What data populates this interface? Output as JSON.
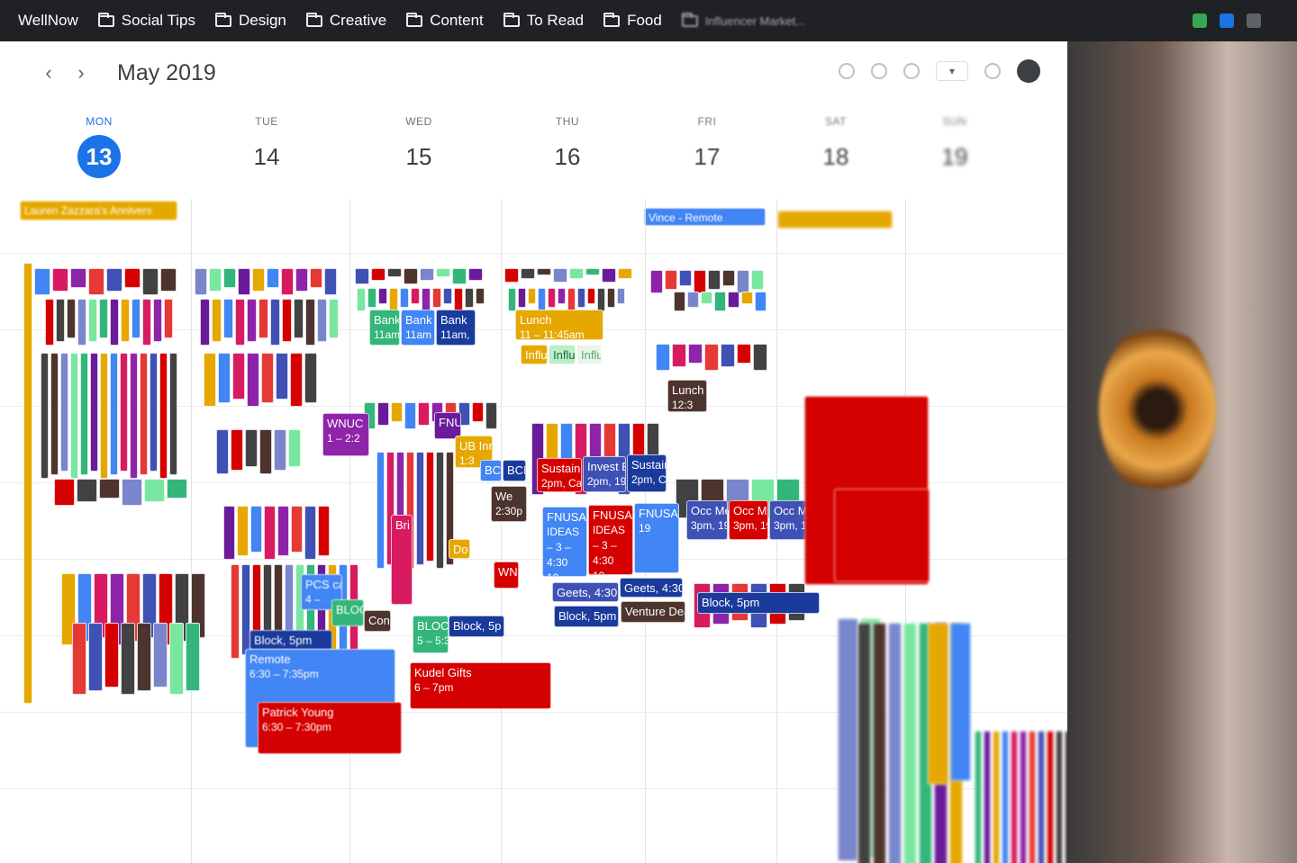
{
  "bookmarks": [
    {
      "label": "WellNow"
    },
    {
      "label": "Social Tips"
    },
    {
      "label": "Design"
    },
    {
      "label": "Creative"
    },
    {
      "label": "Content"
    },
    {
      "label": "To Read"
    },
    {
      "label": "Food"
    },
    {
      "label": "Influencer Market..."
    }
  ],
  "header": {
    "prev": "‹",
    "next": "›",
    "month_title": "May 2019"
  },
  "days": [
    {
      "dow": "MON",
      "num": "13"
    },
    {
      "dow": "TUE",
      "num": "14"
    },
    {
      "dow": "WED",
      "num": "15"
    },
    {
      "dow": "THU",
      "num": "16"
    },
    {
      "dow": "FRI",
      "num": "17"
    },
    {
      "dow": "SAT",
      "num": "18"
    },
    {
      "dow": "SUN",
      "num": "19"
    }
  ],
  "allday": [
    {
      "label": "Lauren Zazzara's Annivers"
    },
    {
      "label": "Vince - Remote"
    }
  ],
  "events": [
    {
      "title": "Bank",
      "time": "11am"
    },
    {
      "title": "Bank",
      "time": "11am"
    },
    {
      "title": "Bank",
      "time": "11am,"
    },
    {
      "title": "Lunch",
      "time": "11 – 11:45am"
    },
    {
      "title": "Influ",
      "time": ""
    },
    {
      "title": "Influ",
      "time": ""
    },
    {
      "title": "Influ",
      "time": ""
    },
    {
      "title": "Lunch",
      "time": "12:3"
    },
    {
      "title": "WNUC",
      "time": "1 – 2:2"
    },
    {
      "title": "FNU",
      "time": ""
    },
    {
      "title": "UB Inn",
      "time": "1:3"
    },
    {
      "title": "BC",
      "time": ""
    },
    {
      "title": "BCI",
      "time": ""
    },
    {
      "title": "Sustain",
      "time": "2pm, Ca"
    },
    {
      "title": "Invest B",
      "time": "2pm, 19"
    },
    {
      "title": "Sustain",
      "time": "2pm, Ca"
    },
    {
      "title": "We",
      "time": "2:30p"
    },
    {
      "title": "FNUSA",
      "time": "IDEAS – 3 – 4:30 19 IDEA"
    },
    {
      "title": "FNUSA",
      "time": "IDEAS – 3 – 4:30 19 IDEA"
    },
    {
      "title": "FNUSA",
      "time": "19"
    },
    {
      "title": "Occ Me",
      "time": "3pm, 19"
    },
    {
      "title": "Occ Me",
      "time": "3pm, 19"
    },
    {
      "title": "Occ Me",
      "time": "3pm, 19"
    },
    {
      "title": "Geets, 4:30p",
      "time": ""
    },
    {
      "title": "Geets, 4:30",
      "time": ""
    },
    {
      "title": "Block, 5pm",
      "time": ""
    },
    {
      "title": "Venture Deal",
      "time": ""
    },
    {
      "title": "Block, 5pm",
      "time": ""
    },
    {
      "title": "BLOC",
      "time": "5 – 5:30pm"
    },
    {
      "title": "Block, 5p",
      "time": ""
    },
    {
      "title": "Block, 5pm",
      "time": ""
    },
    {
      "title": "Remote",
      "time": "6:30 – 7:35pm"
    },
    {
      "title": "Patrick Young",
      "time": "6:30 – 7:30pm"
    },
    {
      "title": "Kudel Gifts",
      "time": "6 – 7pm"
    },
    {
      "title": "PCS ca",
      "time": "4 –"
    },
    {
      "title": "BLOCK",
      "time": ""
    },
    {
      "title": "Con",
      "time": ""
    },
    {
      "title": "Bri",
      "time": ""
    },
    {
      "title": "Do",
      "time": ""
    },
    {
      "title": "WNI",
      "time": ""
    },
    {
      "title": "Block, 5pm",
      "time": ""
    }
  ],
  "colors": {
    "blue": "#4285f4",
    "darkblue": "#3f51b5",
    "navy": "#1a3a9c",
    "red": "#d50000",
    "tomato": "#e53935",
    "green": "#33b679",
    "lightgreen": "#7ae7a0",
    "purple": "#8e24aa",
    "grape": "#6a1b9a",
    "brown": "#4e342e",
    "yellow": "#e6a800",
    "pink": "#d81b60",
    "graphite": "#424242",
    "sage": "#33b679",
    "lavender": "#7986cb"
  }
}
